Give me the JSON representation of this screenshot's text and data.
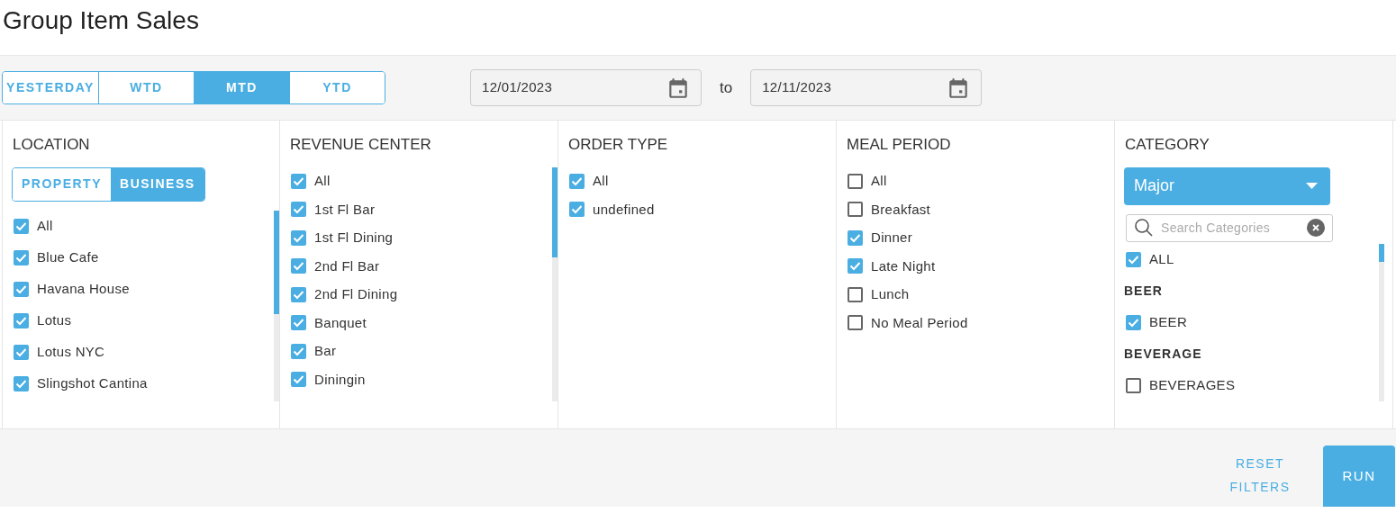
{
  "page": {
    "title": "Group Item Sales"
  },
  "periods": [
    {
      "label": "YESTERDAY",
      "selected": false
    },
    {
      "label": "WTD",
      "selected": false
    },
    {
      "label": "MTD",
      "selected": true
    },
    {
      "label": "YTD",
      "selected": false
    }
  ],
  "date_range": {
    "start": "12/01/2023",
    "separator": "to",
    "end": "12/11/2023"
  },
  "filters": [
    {
      "kind": "location",
      "heading": "LOCATION",
      "modes": [
        {
          "label": "PROPERTY",
          "selected": false
        },
        {
          "label": "BUSINESS",
          "selected": true
        }
      ],
      "options": [
        {
          "label": "All",
          "checked": true
        },
        {
          "label": "Blue Cafe",
          "checked": true
        },
        {
          "label": "Havana House",
          "checked": true
        },
        {
          "label": "Lotus",
          "checked": true
        },
        {
          "label": "Lotus NYC",
          "checked": true
        },
        {
          "label": "Slingshot Cantina",
          "checked": true
        }
      ]
    },
    {
      "kind": "list",
      "heading": "REVENUE CENTER",
      "options": [
        {
          "label": "All",
          "checked": true
        },
        {
          "label": "1st Fl Bar",
          "checked": true
        },
        {
          "label": "1st Fl Dining",
          "checked": true
        },
        {
          "label": "2nd Fl Bar",
          "checked": true
        },
        {
          "label": "2nd Fl Dining",
          "checked": true
        },
        {
          "label": "Banquet",
          "checked": true
        },
        {
          "label": "Bar",
          "checked": true
        },
        {
          "label": "Diningin",
          "checked": true
        }
      ]
    },
    {
      "kind": "list",
      "heading": "ORDER TYPE",
      "options": [
        {
          "label": "All",
          "checked": true
        },
        {
          "label": "undefined",
          "checked": true
        }
      ]
    },
    {
      "kind": "list",
      "heading": "MEAL PERIOD",
      "options": [
        {
          "label": "All",
          "checked": false
        },
        {
          "label": "Breakfast",
          "checked": false
        },
        {
          "label": "Dinner",
          "checked": true
        },
        {
          "label": "Late Night",
          "checked": true
        },
        {
          "label": "Lunch",
          "checked": false
        },
        {
          "label": "No Meal Period",
          "checked": false
        }
      ]
    },
    {
      "kind": "category",
      "heading": "CATEGORY",
      "dropdown": "Major",
      "search": {
        "placeholder": "Search Categories"
      },
      "options": [
        {
          "kind": "check",
          "label": "ALL",
          "checked": true
        },
        {
          "kind": "group",
          "label": "BEER"
        },
        {
          "kind": "check",
          "label": "BEER",
          "checked": true
        },
        {
          "kind": "group",
          "label": "BEVERAGE"
        },
        {
          "kind": "check",
          "label": "BEVERAGES",
          "checked": false
        }
      ]
    }
  ],
  "footer": {
    "reset": "RESET FILTERS",
    "run": "RUN"
  }
}
